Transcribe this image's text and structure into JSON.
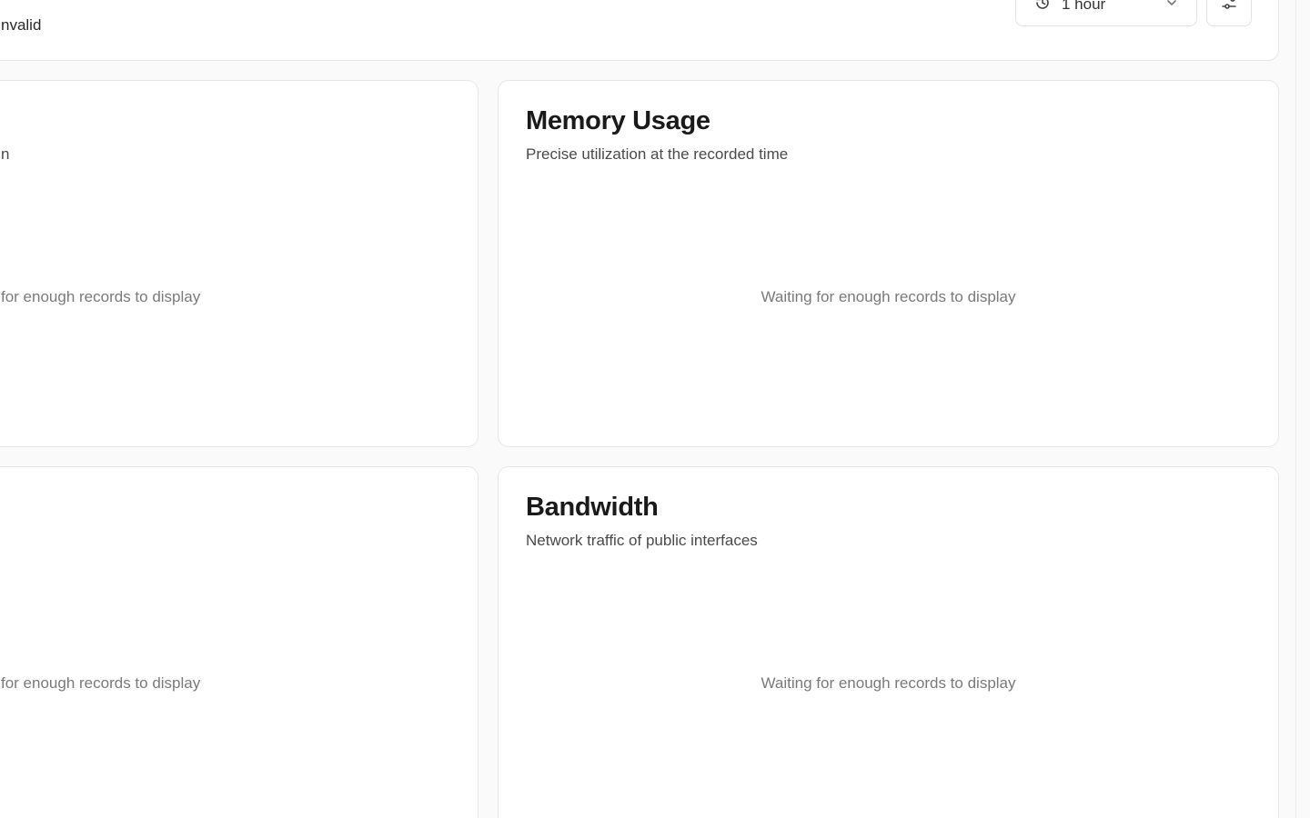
{
  "header": {
    "status_text": "nvalid",
    "time_range": {
      "selected": "1 hour"
    }
  },
  "panels": {
    "left_top": {
      "subtitle_fragment": "n",
      "empty_text_fragment": "for enough records to display"
    },
    "left_bottom": {
      "empty_text_fragment": "for enough records to display"
    },
    "memory": {
      "title": "Memory Usage",
      "subtitle": "Precise utilization at the recorded time",
      "empty_text": "Waiting for enough records to display"
    },
    "bandwidth": {
      "title": "Bandwidth",
      "subtitle": "Network traffic of public interfaces",
      "empty_text": "Waiting for enough records to display"
    }
  },
  "icons": {
    "time_select": "clock-icon",
    "dropdown": "chevron-down-icon",
    "filter": "sliders-icon"
  }
}
